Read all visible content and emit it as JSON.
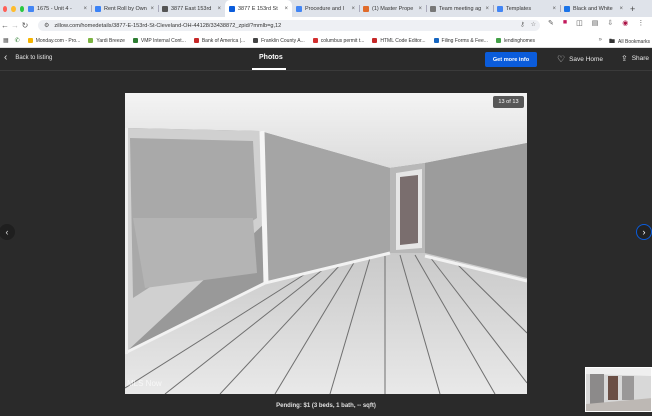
{
  "browser": {
    "tabs": [
      {
        "label": "1675 - Unit 4 - ",
        "color": "#4285f4",
        "active": false
      },
      {
        "label": "Rent Roll by Own",
        "color": "#3b82f6",
        "active": false
      },
      {
        "label": "3877 East 153rd",
        "color": "#555555",
        "active": false
      },
      {
        "label": "3877 E 153rd St",
        "color": "#0b5cdb",
        "active": true
      },
      {
        "label": "Procedure and I",
        "color": "#4285f4",
        "active": false
      },
      {
        "label": "(1) Master Prope",
        "color": "#e06b2a",
        "active": false
      },
      {
        "label": "Team meeting ag",
        "color": "#777777",
        "active": false
      },
      {
        "label": "Templates",
        "color": "#4285f4",
        "active": false
      },
      {
        "label": "Black and White",
        "color": "#1a73e8",
        "active": false
      }
    ],
    "new_tab_label": "+",
    "url": "zillow.com/homedetails/3877-E-153rd-St-Cleveland-OH-44128/33438872_zpid/?mmlb=g,12",
    "bookmarks": [
      {
        "label": "Monday.com - Pro...",
        "color": "#f5b400"
      },
      {
        "label": "Yardi Breeze",
        "color": "#7cb342"
      },
      {
        "label": "VMP Internal Cont...",
        "color": "#2e7d32"
      },
      {
        "label": "Bank of America |...",
        "color": "#c62828"
      },
      {
        "label": "Franklin County A...",
        "color": "#444444"
      },
      {
        "label": "columbus permit t...",
        "color": "#d32f2f"
      },
      {
        "label": "HTML Code Editor...",
        "color": "#c62828"
      },
      {
        "label": "Filing Forms & Fee...",
        "color": "#1565c0"
      },
      {
        "label": "lendinghomes",
        "color": "#43a047"
      }
    ],
    "all_bookmarks_label": "All Bookmarks"
  },
  "viewer": {
    "back_label": "Back to listing",
    "title": "Photos",
    "cta_label": "Get more info",
    "save_label": "Save Home",
    "share_label": "Share",
    "counter": "13 of 13",
    "watermark": "MLS Now",
    "caption": "Pending: $1 (3 beds, 1 bath, -- sqft)"
  },
  "colors": {
    "accent": "#0b5cdb",
    "background": "#2a2a2a"
  }
}
